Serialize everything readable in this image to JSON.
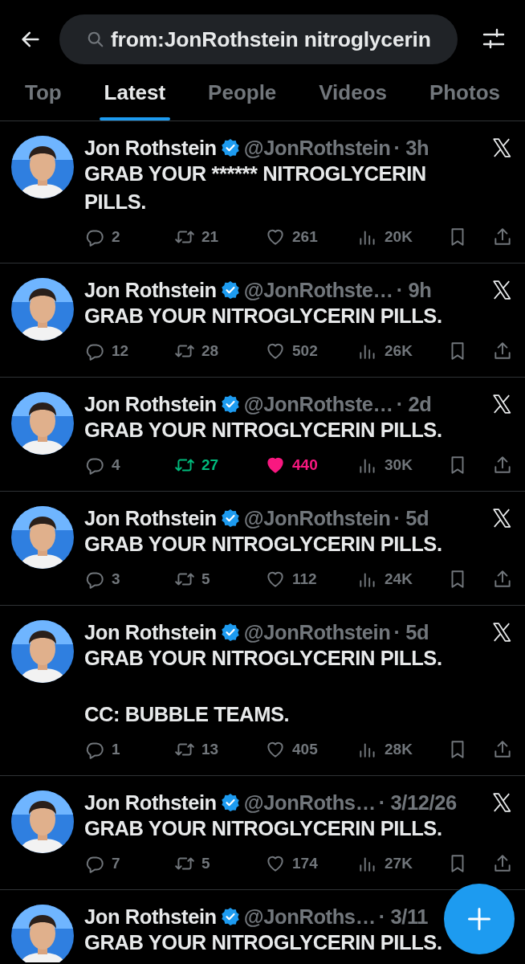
{
  "search": {
    "value": "from:JonRothstein nitroglycerin"
  },
  "tabs": [
    {
      "label": "Top",
      "selected": false
    },
    {
      "label": "Latest",
      "selected": true
    },
    {
      "label": "People",
      "selected": false
    },
    {
      "label": "Videos",
      "selected": false
    },
    {
      "label": "Photos",
      "selected": false
    }
  ],
  "tweets": [
    {
      "name": "Jon Rothstein",
      "verified": true,
      "handle": "@JonRothstein",
      "time": "· 3h",
      "body": [
        "GRAB YOUR ****** NITROGLYCERIN PILLS."
      ],
      "replies": "2",
      "reposts": "21",
      "likes": "261",
      "views": "20K",
      "reposted": false,
      "liked": false
    },
    {
      "name": "Jon Rothstein",
      "verified": true,
      "handle": "@JonRothste…",
      "time": "· 9h",
      "body": [
        "GRAB YOUR NITROGLYCERIN PILLS."
      ],
      "replies": "12",
      "reposts": "28",
      "likes": "502",
      "views": "26K",
      "reposted": false,
      "liked": false
    },
    {
      "name": "Jon Rothstein",
      "verified": true,
      "handle": "@JonRothste…",
      "time": "· 2d",
      "body": [
        "GRAB YOUR NITROGLYCERIN PILLS."
      ],
      "replies": "4",
      "reposts": "27",
      "likes": "440",
      "views": "30K",
      "reposted": true,
      "liked": true
    },
    {
      "name": "Jon Rothstein",
      "verified": true,
      "handle": "@JonRothstein",
      "time": "· 5d",
      "body": [
        "GRAB YOUR NITROGLYCERIN PILLS."
      ],
      "replies": "3",
      "reposts": "5",
      "likes": "112",
      "views": "24K",
      "reposted": false,
      "liked": false
    },
    {
      "name": "Jon Rothstein",
      "verified": true,
      "handle": "@JonRothstein",
      "time": "· 5d",
      "body": [
        "GRAB YOUR NITROGLYCERIN PILLS.",
        "CC: BUBBLE TEAMS."
      ],
      "replies": "1",
      "reposts": "13",
      "likes": "405",
      "views": "28K",
      "reposted": false,
      "liked": false
    },
    {
      "name": "Jon Rothstein",
      "verified": true,
      "handle": "@JonRoths…",
      "time": "· 3/12/26",
      "body": [
        "GRAB YOUR NITROGLYCERIN PILLS."
      ],
      "replies": "7",
      "reposts": "5",
      "likes": "174",
      "views": "27K",
      "reposted": false,
      "liked": false
    },
    {
      "name": "Jon Rothstein",
      "verified": true,
      "handle": "@JonRoths…",
      "time": "· 3/11",
      "body": [
        "GRAB YOUR NITROGLYCERIN PILLS."
      ]
    }
  ]
}
